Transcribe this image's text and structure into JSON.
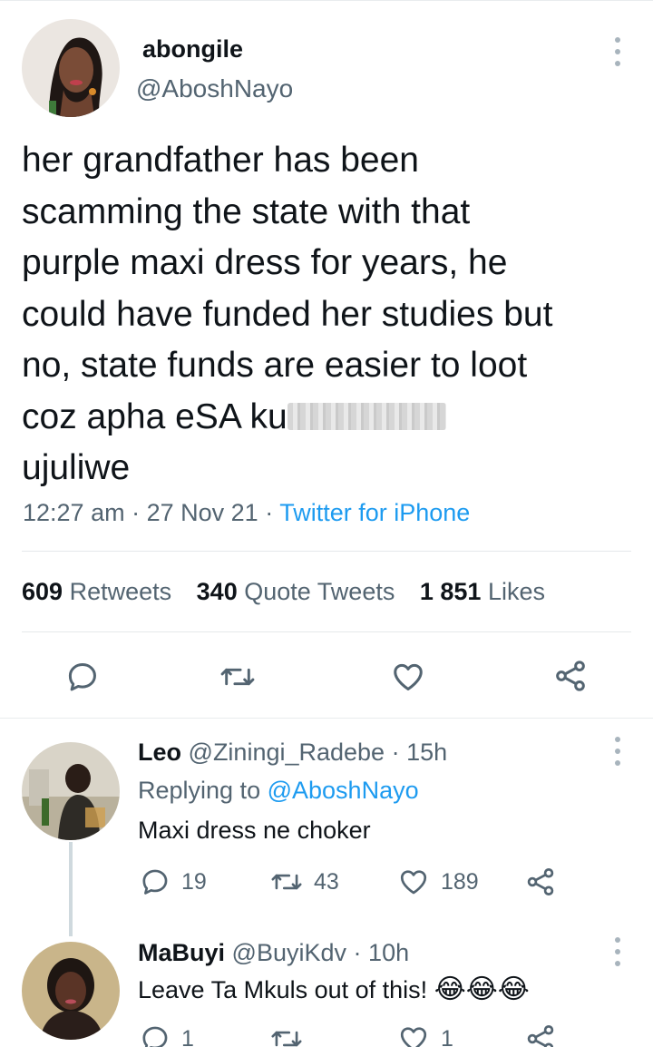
{
  "main_tweet": {
    "author_name": "abongile",
    "author_handle": "@AboshNayo",
    "text_lines": [
      "her grandfather has been",
      "scamming the state with that",
      "purple maxi dress for years, he",
      "could have funded her studies but",
      "no, state funds are easier to loot",
      "coz apha eSA ku",
      "ujuliwe"
    ],
    "time": "12:27 am",
    "date": "27 Nov 21",
    "source": "Twitter for iPhone",
    "meta_separator": "·",
    "stats": {
      "retweets_count": "609",
      "retweets_label": "Retweets",
      "quotes_count": "340",
      "quotes_label": "Quote Tweets",
      "likes_count": "1 851",
      "likes_label": "Likes"
    }
  },
  "replies": [
    {
      "name": "Leo",
      "handle": "@Ziningi_Radebe",
      "time": "15h",
      "replying_to_label": "Replying to",
      "replying_to_handle": "@AboshNayo",
      "text": "Maxi dress ne choker",
      "reply_count": "19",
      "retweet_count": "43",
      "like_count": "189"
    },
    {
      "name": "MaBuyi",
      "handle": "@BuyiKdv",
      "time": "10h",
      "text": "Leave Ta Mkuls out of this!",
      "emojis": "😂😂😂",
      "reply_count": "1",
      "retweet_count": "",
      "like_count": "1"
    }
  ],
  "colors": {
    "accent": "#1d9bf0",
    "text_primary": "#0f1419",
    "text_secondary": "#536471",
    "icon": "#536471",
    "divider": "#e5e8ea"
  },
  "icons": {
    "more": "more-vertical-icon",
    "reply": "comment-bubble-icon",
    "retweet": "retweet-icon",
    "like": "heart-icon",
    "share": "share-icon"
  }
}
